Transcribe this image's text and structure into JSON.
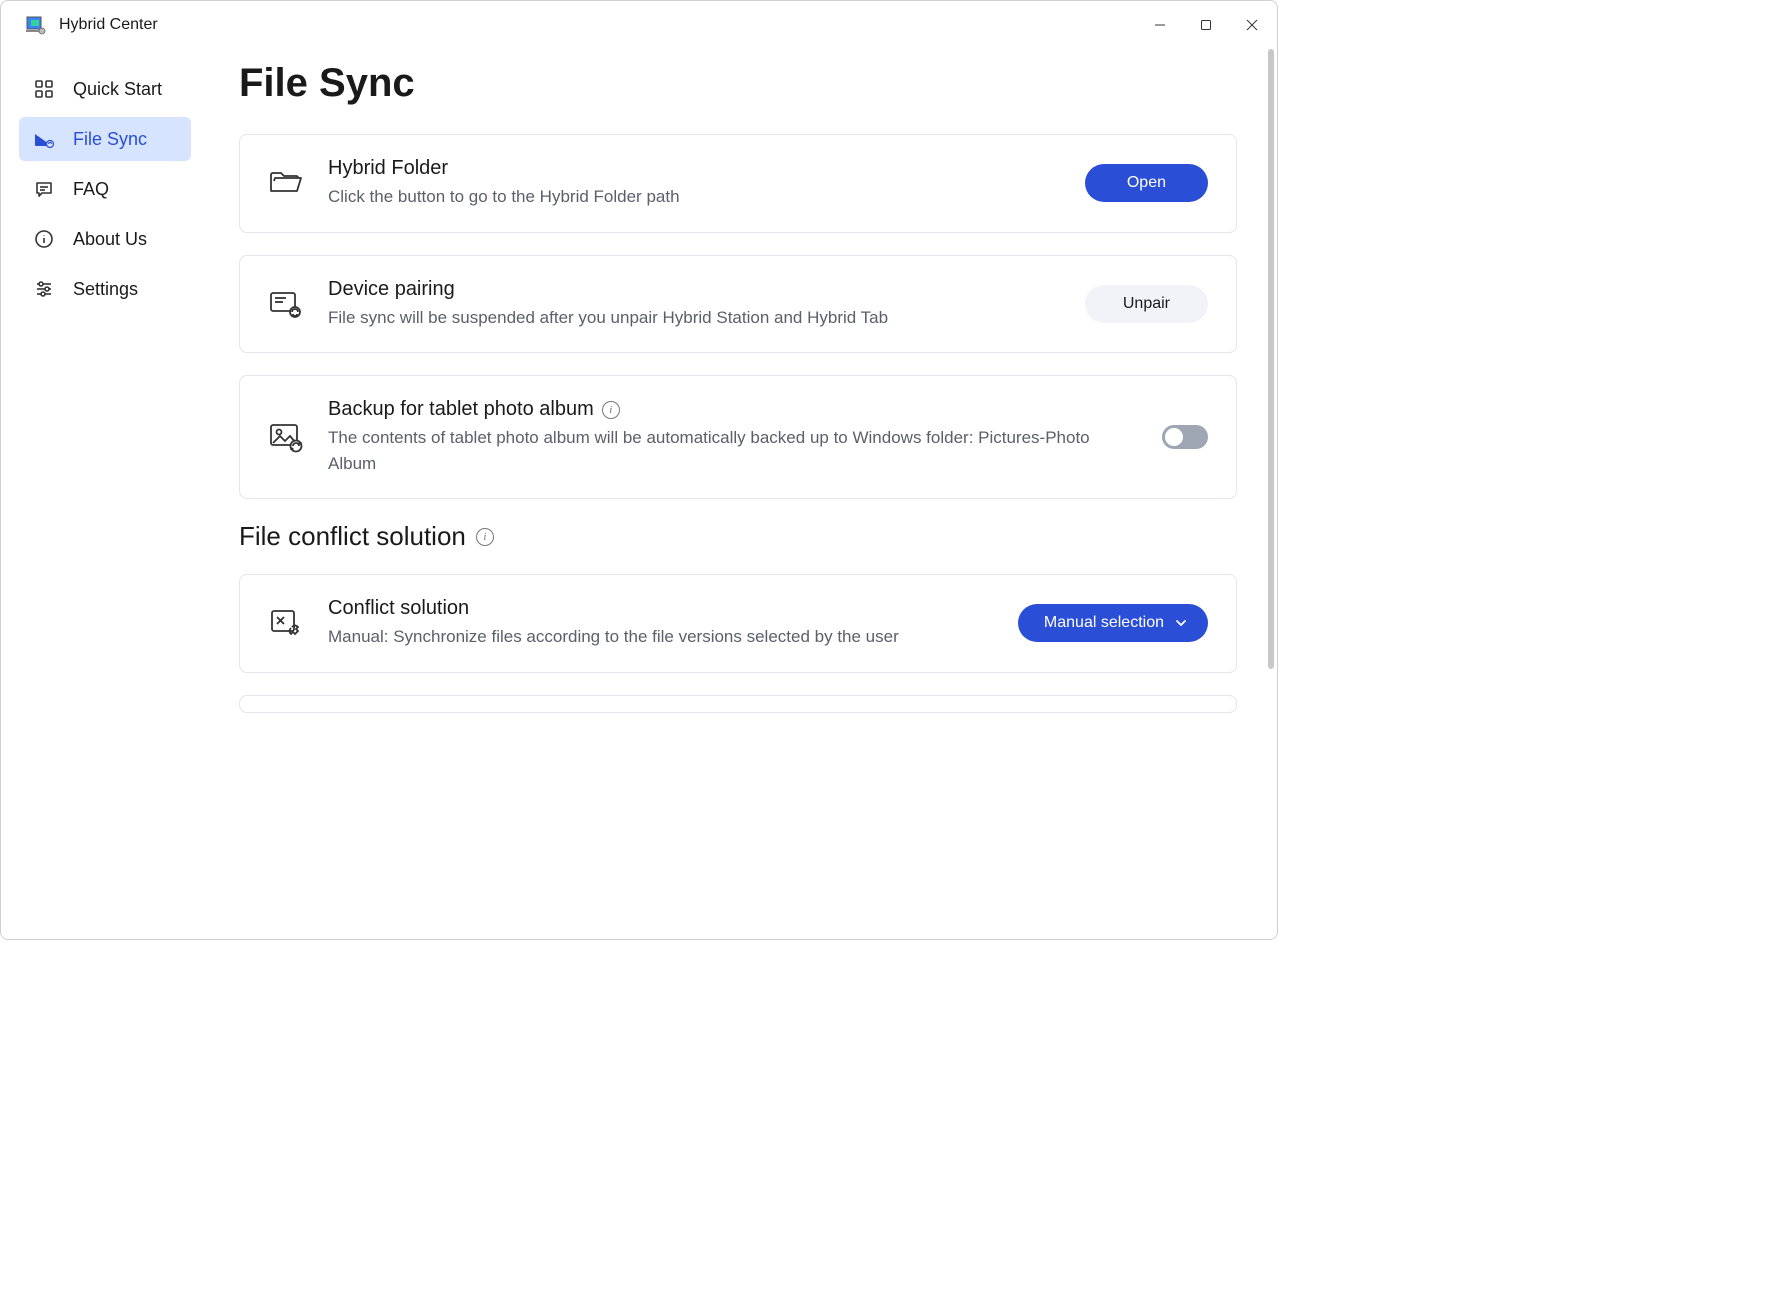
{
  "app": {
    "title": "Hybrid Center"
  },
  "sidebar": {
    "items": [
      {
        "label": "Quick Start"
      },
      {
        "label": "File Sync"
      },
      {
        "label": "FAQ"
      },
      {
        "label": "About Us"
      },
      {
        "label": "Settings"
      }
    ]
  },
  "main": {
    "title": "File Sync",
    "cards": {
      "hybrid_folder": {
        "title": "Hybrid Folder",
        "desc": "Click the button to go to the Hybrid Folder path",
        "action": "Open"
      },
      "device_pairing": {
        "title": "Device pairing",
        "desc": "File sync will be suspended after you unpair Hybrid Station and Hybrid Tab",
        "action": "Unpair"
      },
      "backup": {
        "title": "Backup for tablet photo album",
        "desc": "The contents of tablet photo album will be automatically backed up to Windows folder: Pictures-Photo Album",
        "toggle_on": false
      }
    },
    "section2": {
      "title": "File conflict solution",
      "conflict": {
        "title": "Conflict solution",
        "desc": "Manual: Synchronize files according to the file versions selected by the user",
        "action": "Manual selection"
      }
    }
  },
  "colors": {
    "accent": "#2b4ed6",
    "accent_bg": "#d6e4ff"
  }
}
